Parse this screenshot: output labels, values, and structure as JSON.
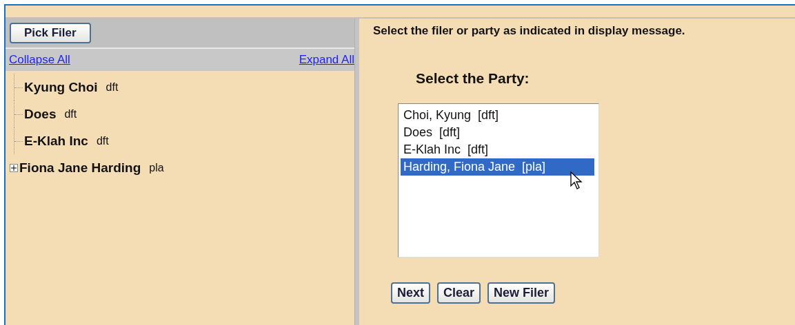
{
  "left_panel": {
    "pick_filer_button": "Pick Filer",
    "collapse_all": "Collapse All",
    "expand_all": "Expand All",
    "tree": [
      {
        "name": "Kyung Choi",
        "role": "dft",
        "expandable": false
      },
      {
        "name": "Does",
        "role": "dft",
        "expandable": false
      },
      {
        "name": "E-Klah Inc",
        "role": "dft",
        "expandable": false
      },
      {
        "name": "Fiona Jane Harding",
        "role": "pla",
        "expandable": true,
        "expanded": false
      }
    ]
  },
  "right_panel": {
    "message": "Select the filer or party as indicated in display message.",
    "heading": "Select the Party:",
    "party_list": [
      {
        "label": "Choi, Kyung  [dft]",
        "selected": false
      },
      {
        "label": "Does  [dft]",
        "selected": false
      },
      {
        "label": "E-Klah Inc  [dft]",
        "selected": false
      },
      {
        "label": "Harding, Fiona Jane  [pla]",
        "selected": true
      }
    ],
    "buttons": [
      "Next",
      "Clear",
      "New Filer"
    ]
  }
}
